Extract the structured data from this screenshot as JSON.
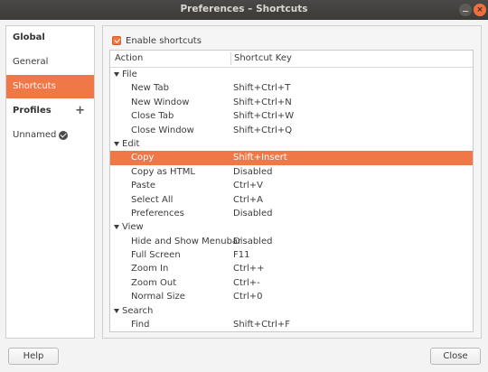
{
  "window": {
    "title": "Preferences – Shortcuts"
  },
  "sidebar": {
    "global_label": "Global",
    "general_label": "General",
    "shortcuts_label": "Shortcuts",
    "profiles_label": "Profiles",
    "add_symbol": "+",
    "profile_name": "Unnamed"
  },
  "content": {
    "enable_label": "Enable shortcuts",
    "enable_checked": true,
    "columns": {
      "action": "Action",
      "key": "Shortcut Key"
    },
    "groups": [
      {
        "name": "File",
        "items": [
          {
            "action": "New Tab",
            "key": "Shift+Ctrl+T"
          },
          {
            "action": "New Window",
            "key": "Shift+Ctrl+N"
          },
          {
            "action": "Close Tab",
            "key": "Shift+Ctrl+W"
          },
          {
            "action": "Close Window",
            "key": "Shift+Ctrl+Q"
          }
        ]
      },
      {
        "name": "Edit",
        "items": [
          {
            "action": "Copy",
            "key": "Shift+Insert",
            "selected": true
          },
          {
            "action": "Copy as HTML",
            "key": "Disabled"
          },
          {
            "action": "Paste",
            "key": "Ctrl+V"
          },
          {
            "action": "Select All",
            "key": "Ctrl+A"
          },
          {
            "action": "Preferences",
            "key": "Disabled"
          }
        ]
      },
      {
        "name": "View",
        "items": [
          {
            "action": "Hide and Show Menubar",
            "key": "Disabled"
          },
          {
            "action": "Full Screen",
            "key": "F11"
          },
          {
            "action": "Zoom In",
            "key": "Ctrl++"
          },
          {
            "action": "Zoom Out",
            "key": "Ctrl+-"
          },
          {
            "action": "Normal Size",
            "key": "Ctrl+0"
          }
        ]
      },
      {
        "name": "Search",
        "items": [
          {
            "action": "Find",
            "key": "Shift+Ctrl+F"
          }
        ]
      }
    ]
  },
  "footer": {
    "help_label": "Help",
    "close_label": "Close"
  },
  "colors": {
    "accent": "#f07746",
    "titlebar": "#3b3a37"
  }
}
